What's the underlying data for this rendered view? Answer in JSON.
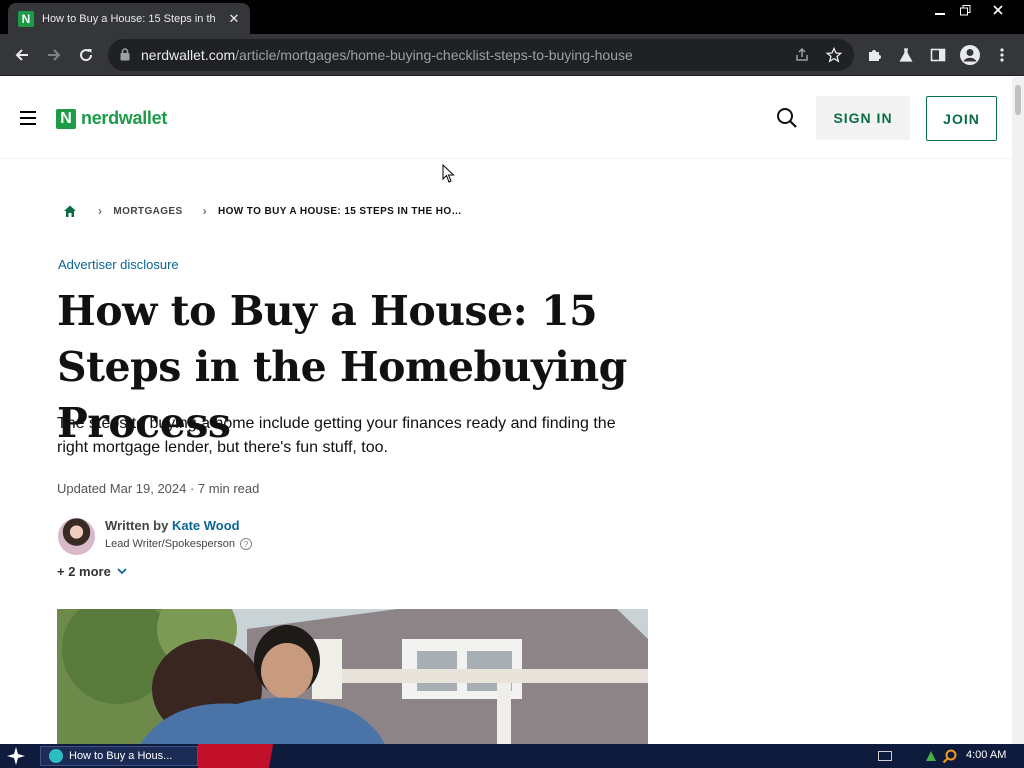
{
  "browser": {
    "tab_title": "How to Buy a House: 15 Steps in th",
    "tab_favicon_letter": "N",
    "url_host": "nerdwallet.com",
    "url_path": "/article/mortgages/home-buying-checklist-steps-to-buying-house"
  },
  "header": {
    "logo_mark": "N",
    "logo_text": "nerdwallet",
    "signin_label": "SIGN IN",
    "join_label": "JOIN",
    "brand_color": "#1d9b48",
    "accent_color": "#0a6e45"
  },
  "breadcrumb": {
    "section": "MORTGAGES",
    "current": "HOW TO BUY A HOUSE: 15 STEPS IN THE HO…"
  },
  "article": {
    "disclosure": "Advertiser disclosure",
    "title": "How to Buy a House: 15 Steps in the Homebuying Process",
    "dek": "The steps to buying a home include getting your finances ready and finding the right mortgage lender, but there's fun stuff, too.",
    "updated": "Updated Mar 19, 2024 · 7 min read",
    "written_by_label": "Written by",
    "author_name": "Kate Wood",
    "author_role": "Lead Writer/Spokesperson",
    "more_authors": "+ 2 more"
  },
  "taskbar": {
    "item_label": "How to Buy a Hous...",
    "clock": "4:00 AM"
  }
}
